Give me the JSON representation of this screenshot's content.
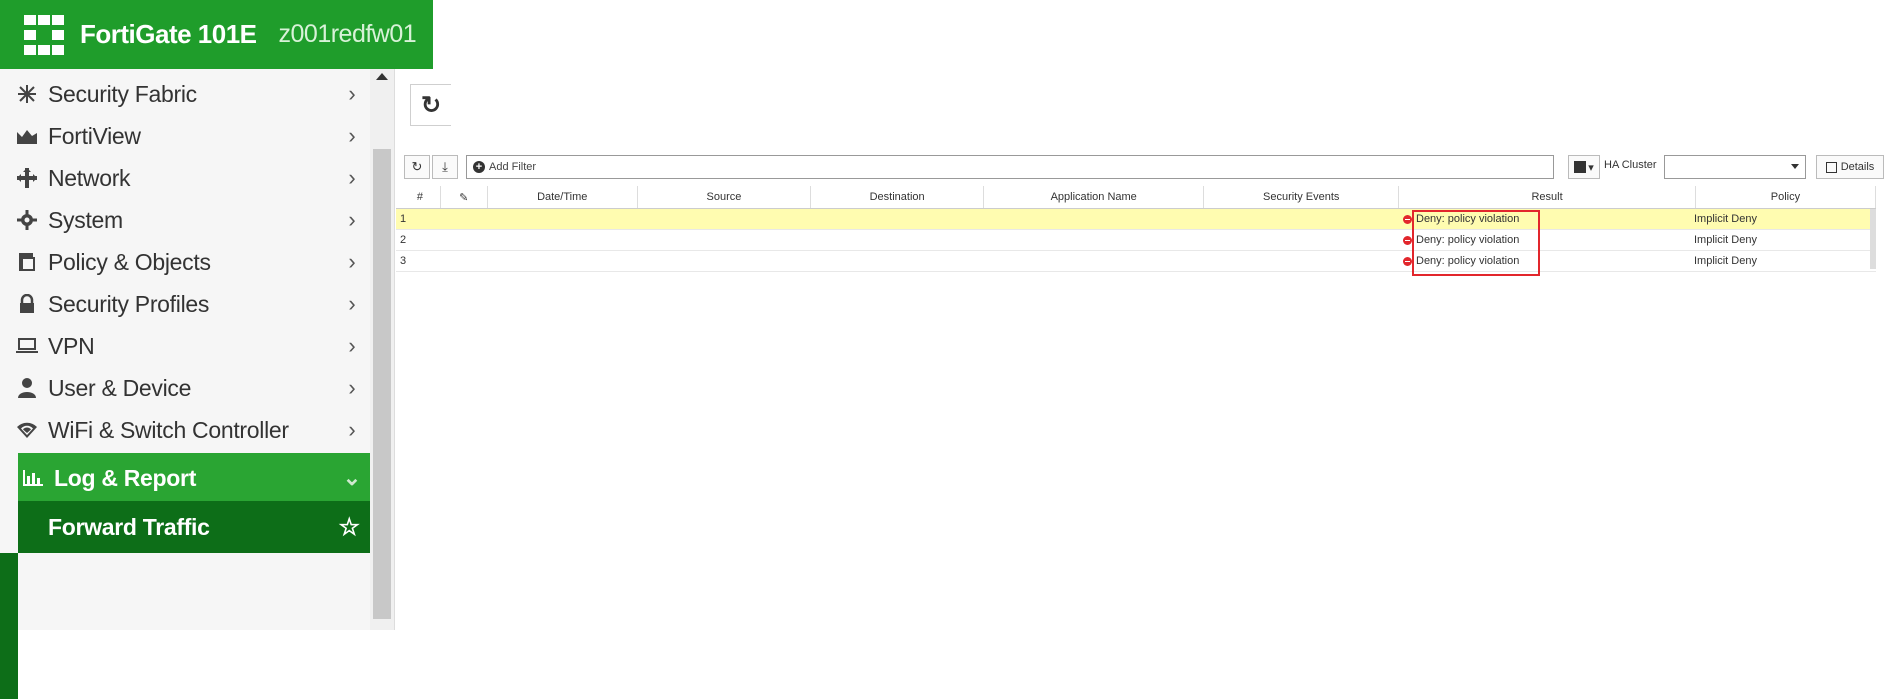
{
  "header": {
    "product": "FortiGate 101E",
    "hostname": "z001redfw01",
    "brand_color": "#1f9d2b"
  },
  "sidebar": {
    "items": [
      {
        "label": "Security Fabric",
        "icon": "security-fabric-icon"
      },
      {
        "label": "FortiView",
        "icon": "fortiview-icon"
      },
      {
        "label": "Network",
        "icon": "network-icon"
      },
      {
        "label": "System",
        "icon": "gear-icon"
      },
      {
        "label": "Policy & Objects",
        "icon": "policy-icon"
      },
      {
        "label": "Security Profiles",
        "icon": "lock-icon"
      },
      {
        "label": "VPN",
        "icon": "laptop-icon"
      },
      {
        "label": "User & Device",
        "icon": "user-icon"
      },
      {
        "label": "WiFi & Switch Controller",
        "icon": "wifi-icon"
      }
    ],
    "active_section": {
      "label": "Log & Report",
      "icon": "chart-icon"
    },
    "active_subitem": {
      "label": "Forward Traffic"
    }
  },
  "toolbar": {
    "add_filter_label": "Add Filter",
    "ha_cluster_label": "HA Cluster",
    "details_label": "Details"
  },
  "table": {
    "columns": [
      "#",
      "",
      "Date/Time",
      "Source",
      "Destination",
      "Application Name",
      "Security Events",
      "Result",
      "Policy"
    ],
    "rows": [
      {
        "num": "1",
        "result": "Deny: policy violation",
        "policy": "Implicit Deny"
      },
      {
        "num": "2",
        "result": "Deny: policy violation",
        "policy": "Implicit Deny"
      },
      {
        "num": "3",
        "result": "Deny: policy violation",
        "policy": "Implicit Deny"
      }
    ]
  },
  "colors": {
    "deny_red": "#e2262c",
    "selected_row": "#fffcb0",
    "active_nav": "#2aa533",
    "sub_nav": "#0d6e18"
  }
}
